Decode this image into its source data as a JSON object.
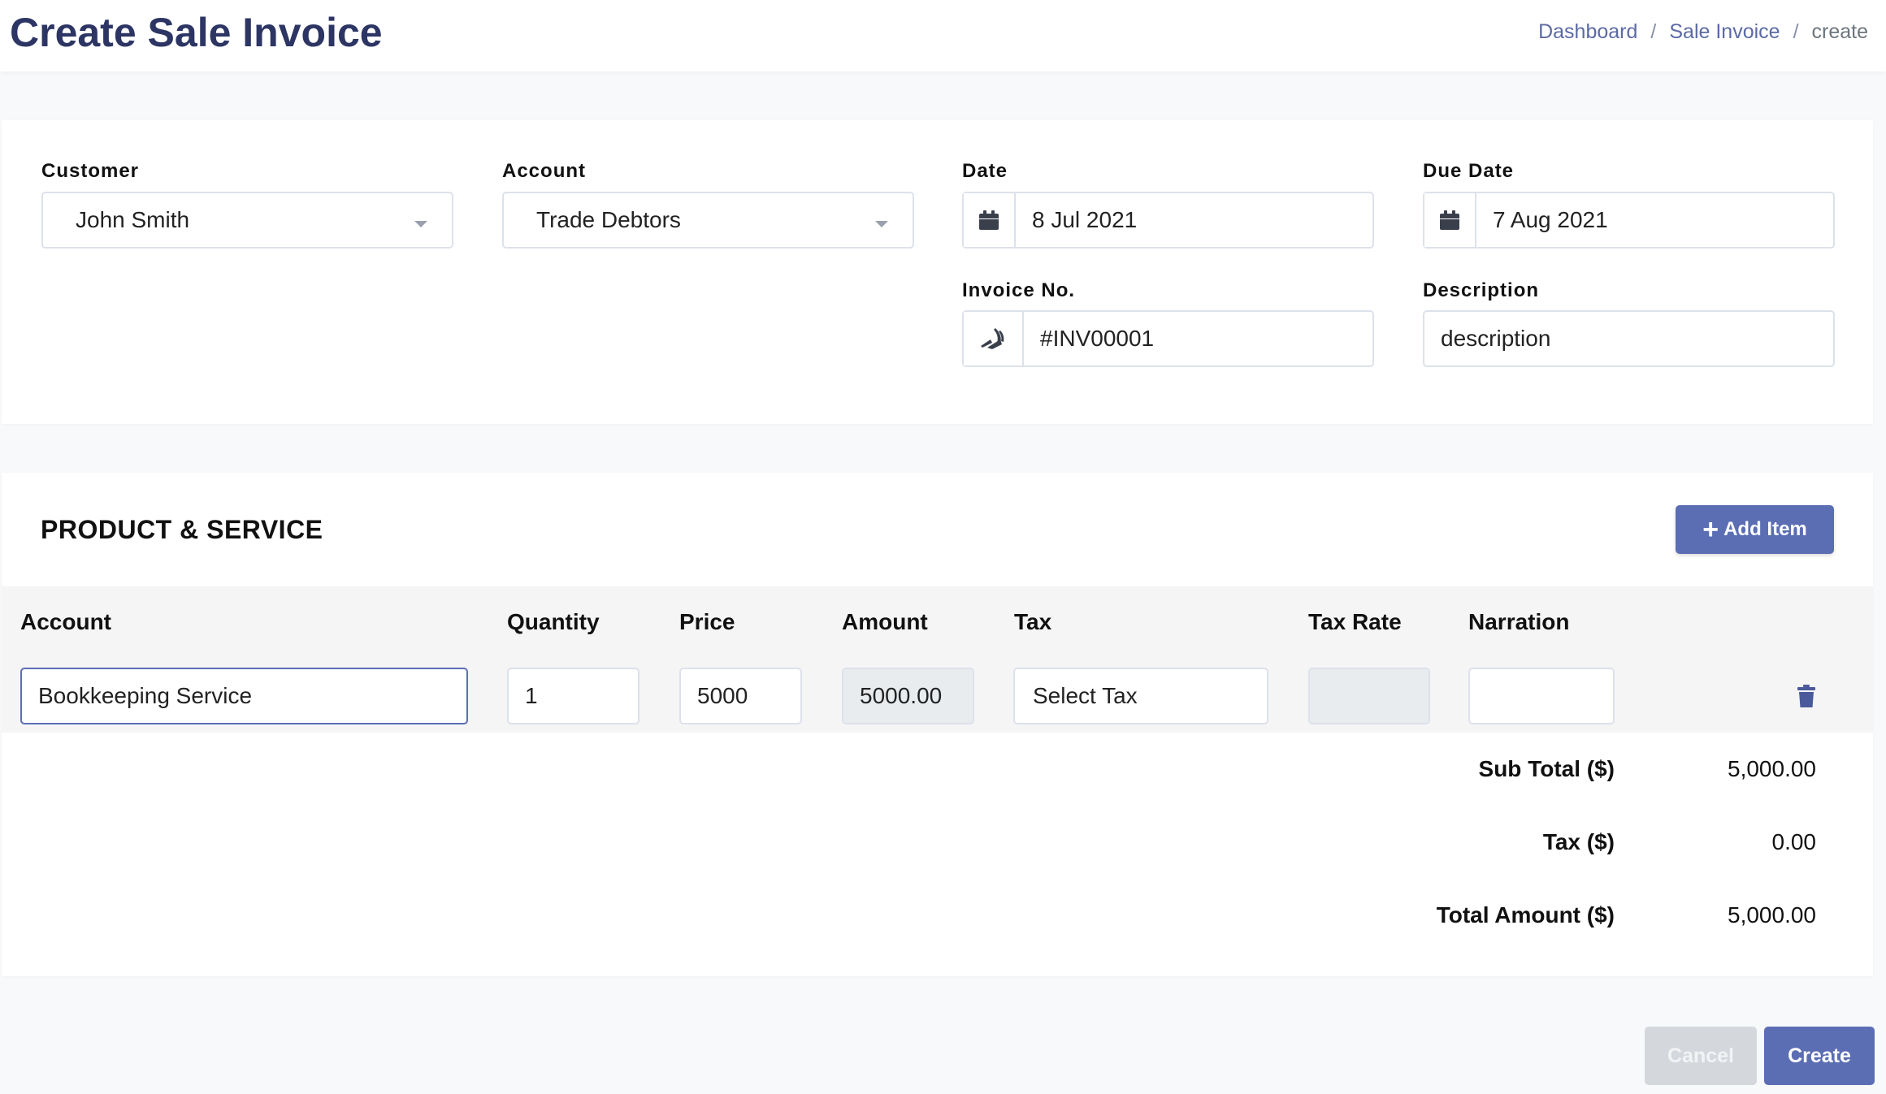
{
  "header": {
    "title": "Create Sale Invoice",
    "breadcrumb": [
      "Dashboard",
      "Sale Invoice",
      "create"
    ],
    "separator": "/"
  },
  "invoice": {
    "customer": {
      "label": "Customer",
      "value": "John Smith"
    },
    "account": {
      "label": "Account",
      "value": "Trade Debtors"
    },
    "date": {
      "label": "Date",
      "value": "8 Jul 2021"
    },
    "due_date": {
      "label": "Due Date",
      "value": "7 Aug 2021"
    },
    "invoice_no": {
      "label": "Invoice No.",
      "value": "#INV00001"
    },
    "description": {
      "label": "Description",
      "value": "description"
    }
  },
  "products": {
    "title": "PRODUCT & SERVICE",
    "add_item_label": "Add Item",
    "columns": [
      "Account",
      "Quantity",
      "Price",
      "Amount",
      "Tax",
      "Tax Rate",
      "Narration"
    ],
    "rows": [
      {
        "account": "Bookkeeping Service",
        "quantity": "1",
        "price": "5000",
        "amount": "5000.00",
        "tax": "Select Tax",
        "tax_rate": "",
        "narration": ""
      }
    ]
  },
  "totals": {
    "sub_total_label": "Sub Total ($)",
    "sub_total": "5,000.00",
    "tax_label": "Tax ($)",
    "tax": "0.00",
    "total_label": "Total Amount ($)",
    "total": "5,000.00"
  },
  "actions": {
    "cancel_label": "Cancel",
    "create_label": "Create"
  },
  "colors": {
    "primary": "#5b6eb4",
    "title": "#2c3563",
    "link": "#5b6aa5"
  }
}
